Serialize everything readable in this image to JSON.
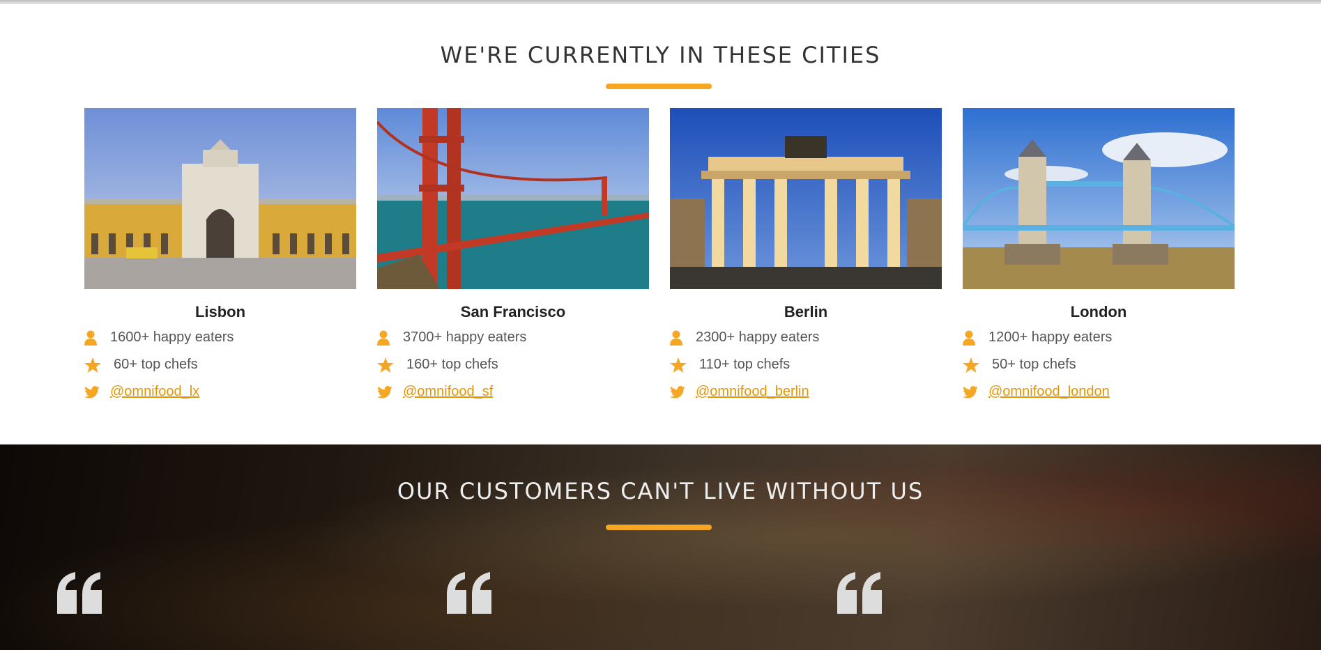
{
  "cities_section": {
    "title": "We're currently in these cities",
    "accent": "#f5a623",
    "cities": [
      {
        "name": "Lisbon",
        "eaters": "1600+ happy eaters",
        "chefs": "60+ top chefs",
        "twitter": "@omnifood_lx"
      },
      {
        "name": "San Francisco",
        "eaters": "3700+ happy eaters",
        "chefs": "160+ top chefs",
        "twitter": "@omnifood_sf"
      },
      {
        "name": "Berlin",
        "eaters": "2300+ happy eaters",
        "chefs": "110+ top chefs",
        "twitter": "@omnifood_berlin"
      },
      {
        "name": "London",
        "eaters": "1200+ happy eaters",
        "chefs": "50+ top chefs",
        "twitter": "@omnifood_london"
      }
    ],
    "icons": {
      "eaters": "person-icon",
      "chefs": "star-icon",
      "twitter": "twitter-icon"
    }
  },
  "testimonials_section": {
    "title": "Our customers can't live without us",
    "quote_icon": "quote-icon"
  }
}
